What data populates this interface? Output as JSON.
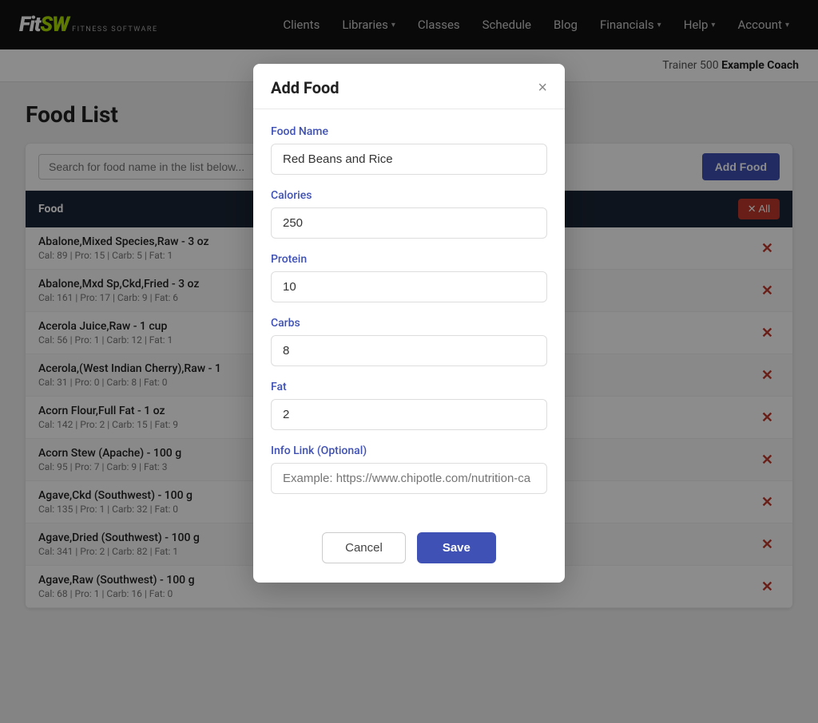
{
  "navbar": {
    "logo_fit": "Fit",
    "logo_sw": "SW",
    "logo_sub": "FITNESS SOFTWARE",
    "links": [
      {
        "label": "Clients",
        "has_arrow": false
      },
      {
        "label": "Libraries",
        "has_arrow": true
      },
      {
        "label": "Classes",
        "has_arrow": false
      },
      {
        "label": "Schedule",
        "has_arrow": false
      },
      {
        "label": "Blog",
        "has_arrow": false
      },
      {
        "label": "Financials",
        "has_arrow": true
      },
      {
        "label": "Help",
        "has_arrow": true
      },
      {
        "label": "Account",
        "has_arrow": true
      }
    ]
  },
  "trainer_bar": {
    "prefix": "Trainer 500",
    "name": "Example Coach"
  },
  "page": {
    "title": "Food List"
  },
  "food_list": {
    "search_placeholder": "Search for food name in the list below...",
    "add_food_label": "Add Food",
    "table_header": "Food",
    "remove_all_label": "✕ All",
    "foods": [
      {
        "name": "Abalone,Mixed Species,Raw - 3 oz",
        "meta": "Cal: 89 | Pro: 15 | Carb: 5 | Fat: 1"
      },
      {
        "name": "Abalone,Mxd Sp,Ckd,Fried - 3 oz",
        "meta": "Cal: 161 | Pro: 17 | Carb: 9 | Fat: 6"
      },
      {
        "name": "Acerola Juice,Raw - 1 cup",
        "meta": "Cal: 56 | Pro: 1 | Carb: 12 | Fat: 1"
      },
      {
        "name": "Acerola,(West Indian Cherry),Raw - 1",
        "meta": "Cal: 31 | Pro: 0 | Carb: 8 | Fat: 0"
      },
      {
        "name": "Acorn Flour,Full Fat - 1 oz",
        "meta": "Cal: 142 | Pro: 2 | Carb: 15 | Fat: 9"
      },
      {
        "name": "Acorn Stew (Apache) - 100 g",
        "meta": "Cal: 95 | Pro: 7 | Carb: 9 | Fat: 3"
      },
      {
        "name": "Agave,Ckd (Southwest) - 100 g",
        "meta": "Cal: 135 | Pro: 1 | Carb: 32 | Fat: 0"
      },
      {
        "name": "Agave,Dried (Southwest) - 100 g",
        "meta": "Cal: 341 | Pro: 2 | Carb: 82 | Fat: 1"
      },
      {
        "name": "Agave,Raw (Southwest) - 100 g",
        "meta": "Cal: 68 | Pro: 1 | Carb: 16 | Fat: 0"
      }
    ]
  },
  "modal": {
    "title": "Add Food",
    "close_label": "×",
    "food_name_label": "Food Name",
    "food_name_value": "Red Beans and Rice",
    "calories_label": "Calories",
    "calories_value": "250",
    "protein_label": "Protein",
    "protein_value": "10",
    "carbs_label": "Carbs",
    "carbs_value": "8",
    "fat_label": "Fat",
    "fat_value": "2",
    "info_link_label": "Info Link (Optional)",
    "info_link_placeholder": "Example: https://www.chipotle.com/nutrition-ca",
    "cancel_label": "Cancel",
    "save_label": "Save"
  }
}
